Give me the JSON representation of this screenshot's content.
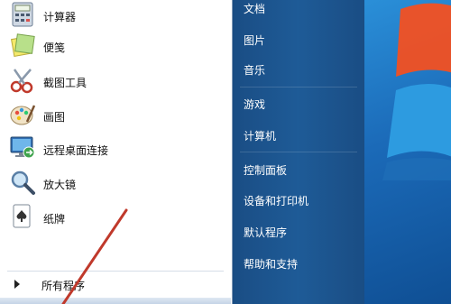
{
  "start_menu": {
    "programs": [
      {
        "label": "计算器",
        "icon": "calculator-icon"
      },
      {
        "label": "便笺",
        "icon": "sticky-notes-icon"
      },
      {
        "label": "截图工具",
        "icon": "snipping-tool-icon"
      },
      {
        "label": "画图",
        "icon": "paint-icon"
      },
      {
        "label": "远程桌面连接",
        "icon": "remote-desktop-icon"
      },
      {
        "label": "放大镜",
        "icon": "magnifier-icon"
      },
      {
        "label": "纸牌",
        "icon": "solitaire-icon"
      }
    ],
    "all_programs_label": "所有程序",
    "right_items": [
      {
        "label": "文档"
      },
      {
        "label": "图片"
      },
      {
        "label": "音乐"
      },
      {
        "label": "游戏"
      },
      {
        "label": "计算机"
      },
      {
        "label": "控制面板"
      },
      {
        "label": "设备和打印机"
      },
      {
        "label": "默认程序"
      },
      {
        "label": "帮助和支持"
      }
    ]
  },
  "colors": {
    "right_pane": "#1e5b97",
    "annotation": "#c0392b"
  }
}
